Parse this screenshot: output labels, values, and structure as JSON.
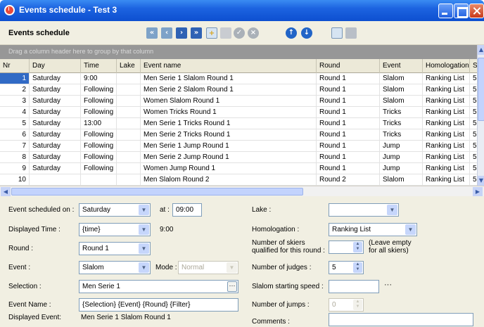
{
  "window": {
    "title": "Events schedule - Test 3"
  },
  "toolbar": {
    "heading": "Events schedule"
  },
  "grid": {
    "group_hint": "Drag a column header here to group by that column",
    "columns": [
      "Nr",
      "Day",
      "Time",
      "Lake",
      "Event name",
      "Round",
      "Event",
      "Homologation",
      "S"
    ],
    "rows": [
      [
        "1",
        "Saturday",
        "9:00",
        "",
        "Men Serie 1 Slalom Round 1",
        "Round 1",
        "Slalom",
        "Ranking List",
        "5"
      ],
      [
        "2",
        "Saturday",
        "Following",
        "",
        "Men Serie 2 Slalom Round 1",
        "Round 1",
        "Slalom",
        "Ranking List",
        "5"
      ],
      [
        "3",
        "Saturday",
        "Following",
        "",
        "Women Slalom Round 1",
        "Round 1",
        "Slalom",
        "Ranking List",
        "5"
      ],
      [
        "4",
        "Saturday",
        "Following",
        "",
        "Women Tricks Round 1",
        "Round 1",
        "Tricks",
        "Ranking List",
        "5"
      ],
      [
        "5",
        "Saturday",
        "13:00",
        "",
        "Men Serie 1 Tricks Round 1",
        "Round 1",
        "Tricks",
        "Ranking List",
        "5"
      ],
      [
        "6",
        "Saturday",
        "Following",
        "",
        "Men Serie 2 Tricks Round 1",
        "Round 1",
        "Tricks",
        "Ranking List",
        "5"
      ],
      [
        "7",
        "Saturday",
        "Following",
        "",
        "Men Serie 1 Jump Round 1",
        "Round 1",
        "Jump",
        "Ranking List",
        "5"
      ],
      [
        "8",
        "Saturday",
        "Following",
        "",
        "Men Serie 2 Jump Round 1",
        "Round 1",
        "Jump",
        "Ranking List",
        "5"
      ],
      [
        "9",
        "Saturday",
        "Following",
        "",
        "Women Jump Round 1",
        "Round 1",
        "Jump",
        "Ranking List",
        "5"
      ],
      [
        "10",
        "",
        "",
        "",
        "Men Slalom Round 2",
        "Round 2",
        "Slalom",
        "Ranking List",
        "5"
      ]
    ]
  },
  "form": {
    "event_scheduled_on": {
      "label": "Event scheduled on :",
      "value": "Saturday"
    },
    "at": {
      "label": "at :",
      "value": "09:00"
    },
    "displayed_time": {
      "label": "Displayed Time :",
      "value": "{time}",
      "preview": "9:00"
    },
    "round": {
      "label": "Round :",
      "value": "Round 1"
    },
    "event": {
      "label": "Event :",
      "value": "Slalom"
    },
    "mode": {
      "label": "Mode :",
      "value": "Normal"
    },
    "selection": {
      "label": "Selection :",
      "value": "Men Serie 1"
    },
    "event_name": {
      "label": "Event Name :",
      "value": "{Selection} {Event} {Round} {Filter}"
    },
    "displayed_event": {
      "label": "Displayed Event:",
      "value": "Men Serie 1 Slalom Round 1"
    },
    "lake": {
      "label": "Lake :",
      "value": ""
    },
    "homologation": {
      "label": "Homologation :",
      "value": "Ranking List"
    },
    "skiers_qualified": {
      "label_line1": "Number of skiers",
      "label_line2": "qualified for this round :",
      "value": "",
      "hint_line1": "(Leave empty",
      "hint_line2": "for all skiers)"
    },
    "judges": {
      "label": "Number of judges :",
      "value": "5"
    },
    "slalom_speed": {
      "label": "Slalom starting speed :",
      "value": "",
      "ellipsis": "···"
    },
    "jumps": {
      "label": "Number of jumps :",
      "value": "0"
    },
    "comments": {
      "label": "Comments :",
      "value": ""
    }
  },
  "colors": {
    "titlebar": "#0d4fd0",
    "selected_row": "#316ac5",
    "group_bar": "#979797"
  }
}
